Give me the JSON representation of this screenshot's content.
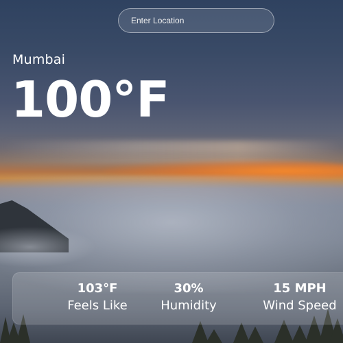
{
  "search": {
    "placeholder": "Enter Location"
  },
  "weather": {
    "location": "Mumbai",
    "temperature": "100°F"
  },
  "stats": {
    "feels_like": {
      "value": "103°F",
      "label": "Feels Like"
    },
    "humidity": {
      "value": "30%",
      "label": "Humidity"
    },
    "wind_speed": {
      "value": "15 MPH",
      "label": "Wind Speed"
    }
  }
}
